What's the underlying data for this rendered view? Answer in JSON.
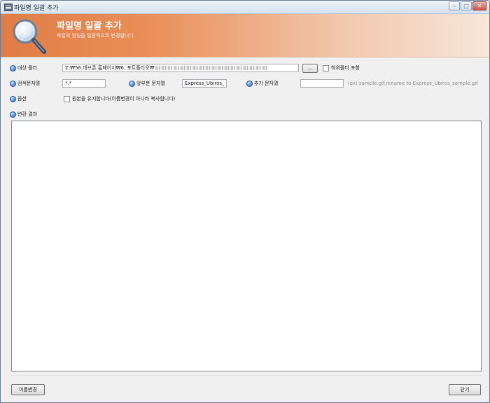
{
  "window": {
    "title": "파일명 일괄 추가",
    "min_glyph": "–",
    "max_glyph": "□",
    "close_glyph": "✕"
  },
  "header": {
    "title": "파일명 일괄 추가",
    "subtitle": "파일의 명칭을 일괄적으로 변경합니다."
  },
  "form": {
    "target_folder_label": "대상 폴더",
    "target_folder_value": "Z:₩56.데브존 홈페이지₩6. 포트폴리오₩",
    "browse_label": "...",
    "include_subfolders_label": "하위폴더 포함",
    "search_string_label": "검색문자열",
    "search_string_value": "*.*",
    "prefix_label": "앞부분 문자열",
    "prefix_value": "Express_Ubiros_",
    "suffix_label": "추가 문자열",
    "suffix_value": "",
    "example_hint": "(ex) sample.gif.rename to  Express_Ubiros_sample.gif",
    "option_label": "옵션",
    "keep_original_label": "원본을 유지합니다(이름변경이 아니라 복사합니다)",
    "result_label": "변환 결과"
  },
  "footer": {
    "rename_button": "이름변경",
    "close_button": "닫기"
  },
  "colors": {
    "header_start": "#e07d46",
    "header_end": "#f7e6da",
    "bullet": "#4f86d6"
  }
}
